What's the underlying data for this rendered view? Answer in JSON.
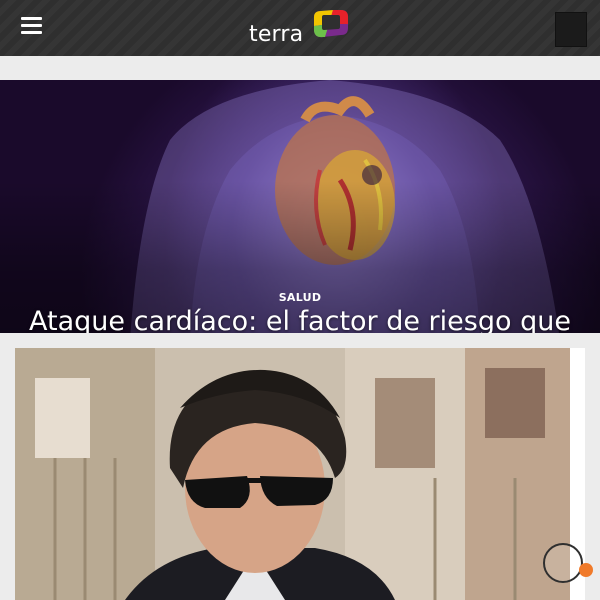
{
  "header": {
    "logo_text": "terra",
    "menu_icon": "hamburger-menu-icon",
    "logo_icon": "terra-logo-mark-icon",
    "account_icon": "account-box-icon",
    "colors": {
      "bar": "#2f2f2f",
      "logo_green": "#6cc04a",
      "logo_yellow": "#f2c500",
      "logo_red": "#e6212a",
      "logo_purple": "#7a2a8c"
    }
  },
  "hero": {
    "tag": "SALUD",
    "title": "Ataque cardíaco: el factor de riesgo que afecta a un tercio de los adultos y podría causarle la muerte",
    "image": "heart-anatomy-illustration"
  },
  "card": {
    "image": "man-in-sunglasses-photo"
  },
  "floating_widget": {
    "icon": "circle-launcher-icon",
    "accent": "#f07a2a"
  }
}
